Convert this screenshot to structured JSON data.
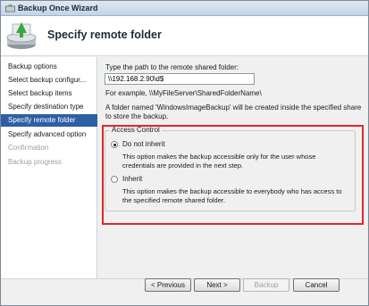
{
  "window": {
    "title": "Backup Once Wizard"
  },
  "header": {
    "title": "Specify remote folder"
  },
  "sidebar": {
    "items": [
      {
        "label": "Backup options",
        "state": "normal"
      },
      {
        "label": "Select backup configur...",
        "state": "normal"
      },
      {
        "label": "Select backup items",
        "state": "normal"
      },
      {
        "label": "Specify destination type",
        "state": "normal"
      },
      {
        "label": "Specify remote folder",
        "state": "active"
      },
      {
        "label": "Specify advanced option",
        "state": "normal"
      },
      {
        "label": "Confirmation",
        "state": "disabled"
      },
      {
        "label": "Backup progress",
        "state": "disabled"
      }
    ]
  },
  "content": {
    "path_label": "Type the path to the remote shared folder:",
    "path_value": "\\\\192.168.2.90\\d$",
    "example": "For example, \\\\MyFileServer\\SharedFolderName\\",
    "info_line1": "A folder named 'WindowsImageBackup' will be created inside the specified share",
    "info_line2": "to store the backup.",
    "access": {
      "legend": "Access Control",
      "options": [
        {
          "label": "Do not inherit",
          "checked": true,
          "desc1": "This option makes the backup accessible only for the user whose",
          "desc2": "credentials are provided in the next step."
        },
        {
          "label": "Inherit",
          "checked": false,
          "desc1": "This option makes the backup accessible to everybody who has access to",
          "desc2": "the specified remote shared folder."
        }
      ]
    }
  },
  "footer": {
    "prev_label": "< Previous",
    "next_label": "Next >",
    "backup_label": "Backup",
    "cancel_label": "Cancel"
  },
  "colors": {
    "active_nav": "#2e5fa3",
    "highlight": "#e0262a"
  }
}
